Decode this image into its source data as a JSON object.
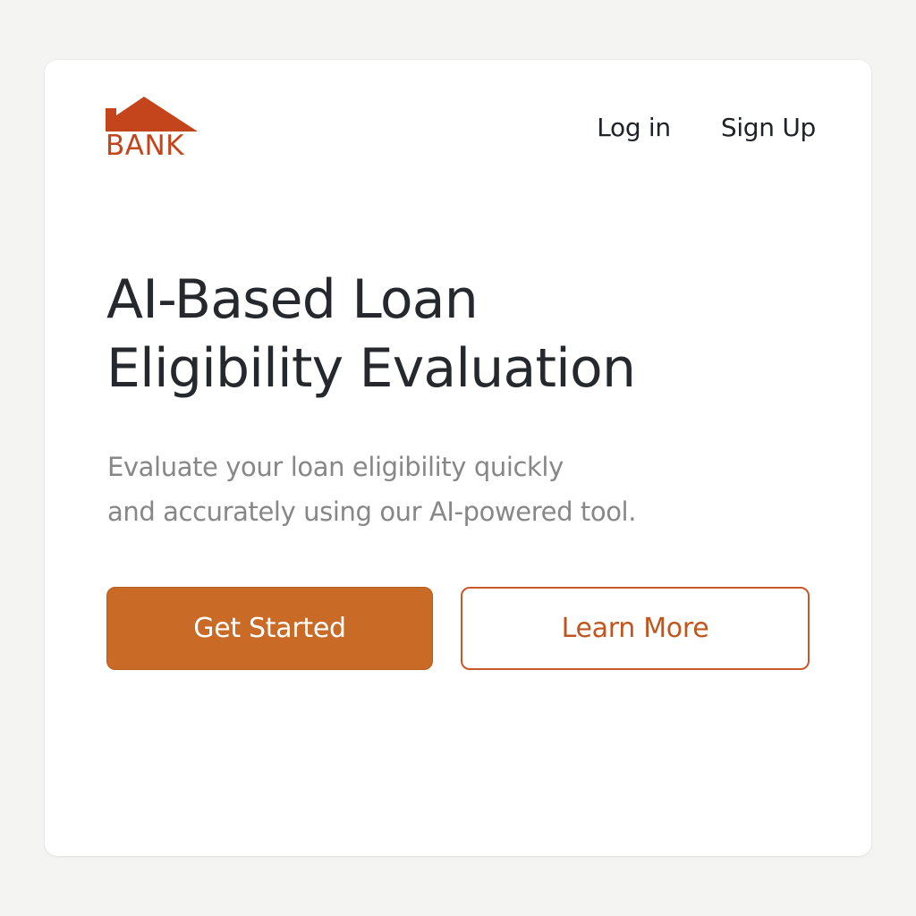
{
  "brand": {
    "logo_text": "BANK",
    "logo_icon": "house-roof-icon",
    "color": "#c4441c"
  },
  "nav": {
    "login_label": "Log in",
    "signup_label": "Sign Up"
  },
  "hero": {
    "title_line1": "AI-Based Loan",
    "title_line2": "Eligibility Evaluation",
    "subtitle_line1": "Evaluate your loan eligibility quickly",
    "subtitle_line2": "and accurately using our AI-powered tool."
  },
  "actions": {
    "primary_label": "Get Started",
    "secondary_label": "Learn More"
  },
  "colors": {
    "accent": "#c96a27",
    "accent_outline": "#c8582a",
    "heading": "#25282c",
    "muted": "#878787"
  }
}
